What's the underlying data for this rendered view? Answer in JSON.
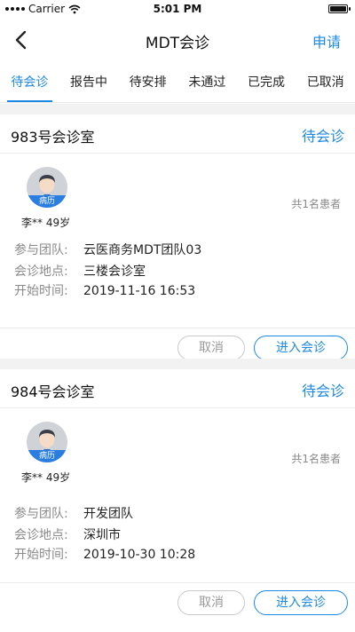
{
  "status_bar": {
    "carrier": "Carrier",
    "time": "5:01 PM"
  },
  "header": {
    "title": "MDT会诊",
    "action": "申请"
  },
  "tabs": [
    {
      "label": "待会诊",
      "active": true
    },
    {
      "label": "报告中",
      "active": false
    },
    {
      "label": "待安排",
      "active": false
    },
    {
      "label": "未通过",
      "active": false
    },
    {
      "label": "已完成",
      "active": false
    },
    {
      "label": "已取消",
      "active": false
    }
  ],
  "labels": {
    "team": "参与团队:",
    "location": "会诊地点:",
    "start_time": "开始时间:"
  },
  "cards": [
    {
      "room": "983号会诊室",
      "status": "待会诊",
      "patient_count": "共1名患者",
      "avatar_tag": "病历",
      "patient": "李** 49岁",
      "team": "云医商务MDT团队03",
      "location": "三楼会诊室",
      "start_time": "2019-11-16 16:53",
      "cancel_label": "取消",
      "enter_label": "进入会诊"
    },
    {
      "room": "984号会诊室",
      "status": "待会诊",
      "patient_count": "共1名患者",
      "avatar_tag": "病历",
      "patient": "李** 49岁",
      "team": "开发团队",
      "location": "深圳市",
      "start_time": "2019-10-30 10:28",
      "cancel_label": "取消",
      "enter_label": "进入会诊"
    }
  ],
  "colors": {
    "accent": "#1e88e5",
    "avatar_tag": "#2a7de1",
    "muted": "#8a8a8a"
  },
  "icons": {
    "back": "chevron-left-icon",
    "wifi": "wifi-icon",
    "battery": "battery-icon"
  }
}
